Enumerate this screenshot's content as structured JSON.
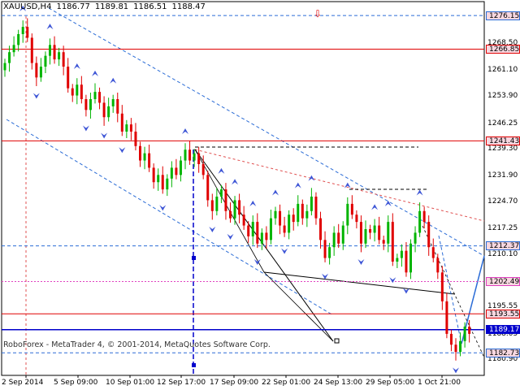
{
  "header": {
    "symbol": "XAUUSD,H4",
    "open": "1186.77",
    "high": "1189.81",
    "low": "1186.51",
    "close": "1188.47"
  },
  "copyright": "RoboForex - MetaTrader 4, © 2001-2014, MetaQuotes Software Corp.",
  "colors": {
    "bull": "#00b400",
    "bear": "#e00000",
    "level_line": "#e00000",
    "blue": "#0000cc",
    "forecast": "#2b6cd6",
    "fractal": "#3d55d6",
    "label_bg": "#f7d7e0"
  },
  "chart_data": {
    "type": "candlestick",
    "symbol": "XAUUSD",
    "timeframe": "H4",
    "ylim": [
      1176.5,
      1280.0
    ],
    "y_ticks": [
      "1276.15",
      "1268.50",
      "1261.10",
      "1253.90",
      "1246.25",
      "1239.30",
      "1231.90",
      "1224.70",
      "1217.25",
      "1210.10",
      "1195.55",
      "1188.05",
      "1180.90"
    ],
    "x_ticks": [
      "2 Sep 2014",
      "5 Sep 09:00",
      "10 Sep 01:00",
      "12 Sep 17:00",
      "17 Sep 09:00",
      "22 Sep 01:00",
      "24 Sep 13:00",
      "29 Sep 05:00",
      "1 Oct 21:00"
    ],
    "levels": [
      {
        "label": "1276.15",
        "value": 1276.15,
        "style": "dashed-blue"
      },
      {
        "label": "1266.85",
        "value": 1266.85,
        "style": "red"
      },
      {
        "label": "1241.43",
        "value": 1241.43,
        "style": "red"
      },
      {
        "label": "1212.37",
        "value": 1212.37,
        "style": "dashed-blue"
      },
      {
        "label": "1202.49",
        "value": 1202.49,
        "style": "dotted-magenta"
      },
      {
        "label": "1193.55",
        "value": 1193.55,
        "style": "red"
      },
      {
        "label": "1189.17",
        "value": 1189.17,
        "style": "blue"
      },
      {
        "label": "1182.73",
        "value": 1182.73,
        "style": "dashed-blue"
      }
    ],
    "close_series": [
      1263,
      1266,
      1268,
      1271,
      1273,
      1270,
      1263,
      1259,
      1262,
      1265,
      1268,
      1264,
      1266,
      1262,
      1256,
      1254,
      1257,
      1253,
      1250,
      1253,
      1255,
      1252,
      1248,
      1251,
      1253,
      1249,
      1244,
      1246,
      1244,
      1240,
      1236,
      1238,
      1234,
      1230,
      1232,
      1228,
      1231,
      1234,
      1232,
      1236,
      1239,
      1236,
      1238,
      1235,
      1232,
      1225,
      1222,
      1226,
      1228,
      1222,
      1220,
      1225,
      1221,
      1218,
      1215,
      1219,
      1213,
      1216,
      1214,
      1220,
      1222,
      1218,
      1216,
      1221,
      1219,
      1224,
      1220,
      1222,
      1226,
      1220,
      1214,
      1209,
      1212,
      1216,
      1213,
      1218,
      1224,
      1221,
      1219,
      1213,
      1217,
      1216,
      1218,
      1214,
      1213,
      1219,
      1208,
      1209,
      1211,
      1205,
      1213,
      1216,
      1222,
      1219,
      1212,
      1209,
      1205,
      1197,
      1188,
      1185,
      1183,
      1186,
      1190,
      1188
    ]
  }
}
